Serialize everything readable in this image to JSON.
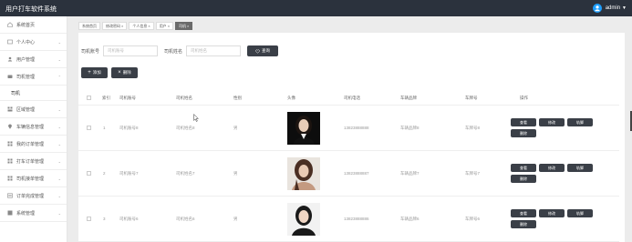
{
  "header": {
    "app_title": "用户打车软件系统",
    "user": "admin"
  },
  "sidebar": {
    "items": [
      {
        "label": "系统首页",
        "icon": "home-icon",
        "expandable": false
      },
      {
        "label": "个人中心",
        "icon": "user-icon",
        "expandable": true
      },
      {
        "label": "用户管理",
        "icon": "users-icon",
        "expandable": true
      },
      {
        "label": "司机管理",
        "icon": "car-icon",
        "expandable": true,
        "expanded": true
      },
      {
        "label": "区域管理",
        "icon": "grid-icon",
        "expandable": true
      },
      {
        "label": "车辆信息管理",
        "icon": "pin-icon",
        "expandable": true
      },
      {
        "label": "我的订单管理",
        "icon": "grid-icon",
        "expandable": true
      },
      {
        "label": "打车订单管理",
        "icon": "grid-icon",
        "expandable": true
      },
      {
        "label": "司机接单管理",
        "icon": "grid-icon",
        "expandable": true
      },
      {
        "label": "订单完成管理",
        "icon": "list-icon",
        "expandable": true
      },
      {
        "label": "系统管理",
        "icon": "settings-icon",
        "expandable": true
      }
    ],
    "sub_item": "司机"
  },
  "tabs": [
    {
      "label": "系统首页",
      "closable": false,
      "active": false
    },
    {
      "label": "修改密码",
      "closable": true,
      "active": false
    },
    {
      "label": "个人信息",
      "closable": true,
      "active": false
    },
    {
      "label": "用户",
      "closable": true,
      "active": false
    },
    {
      "label": "司机",
      "closable": true,
      "active": true
    }
  ],
  "search": {
    "label1": "司机账号",
    "placeholder1": "司机账号",
    "label2": "司机姓名",
    "placeholder2": "司机姓名",
    "button": "查询"
  },
  "actions": {
    "add": "添加",
    "delete": "删除"
  },
  "table": {
    "headers": [
      "",
      "索引",
      "司机账号",
      "司机姓名",
      "性别",
      "头像",
      "司机电话",
      "车辆品牌",
      "车牌号",
      "操作"
    ],
    "rows": [
      {
        "index": "1",
        "account": "司机账号8",
        "name": "司机姓名8",
        "gender": "男",
        "phone": "13823888888",
        "brand": "车辆品牌8",
        "plate": "车牌号8"
      },
      {
        "index": "2",
        "account": "司机账号7",
        "name": "司机姓名7",
        "gender": "男",
        "phone": "13823888887",
        "brand": "车辆品牌7",
        "plate": "车牌号7"
      },
      {
        "index": "3",
        "account": "司机账号6",
        "name": "司机姓名6",
        "gender": "男",
        "phone": "13823888886",
        "brand": "车辆品牌6",
        "plate": "车牌号6"
      }
    ],
    "row_buttons": [
      "查看",
      "修改",
      "轨脚",
      "删除"
    ]
  },
  "colors": {
    "topbar": "#2b323d",
    "button": "#3a3f47",
    "active_tab": "#6a6a6a",
    "avatar": "#1e9fff"
  }
}
